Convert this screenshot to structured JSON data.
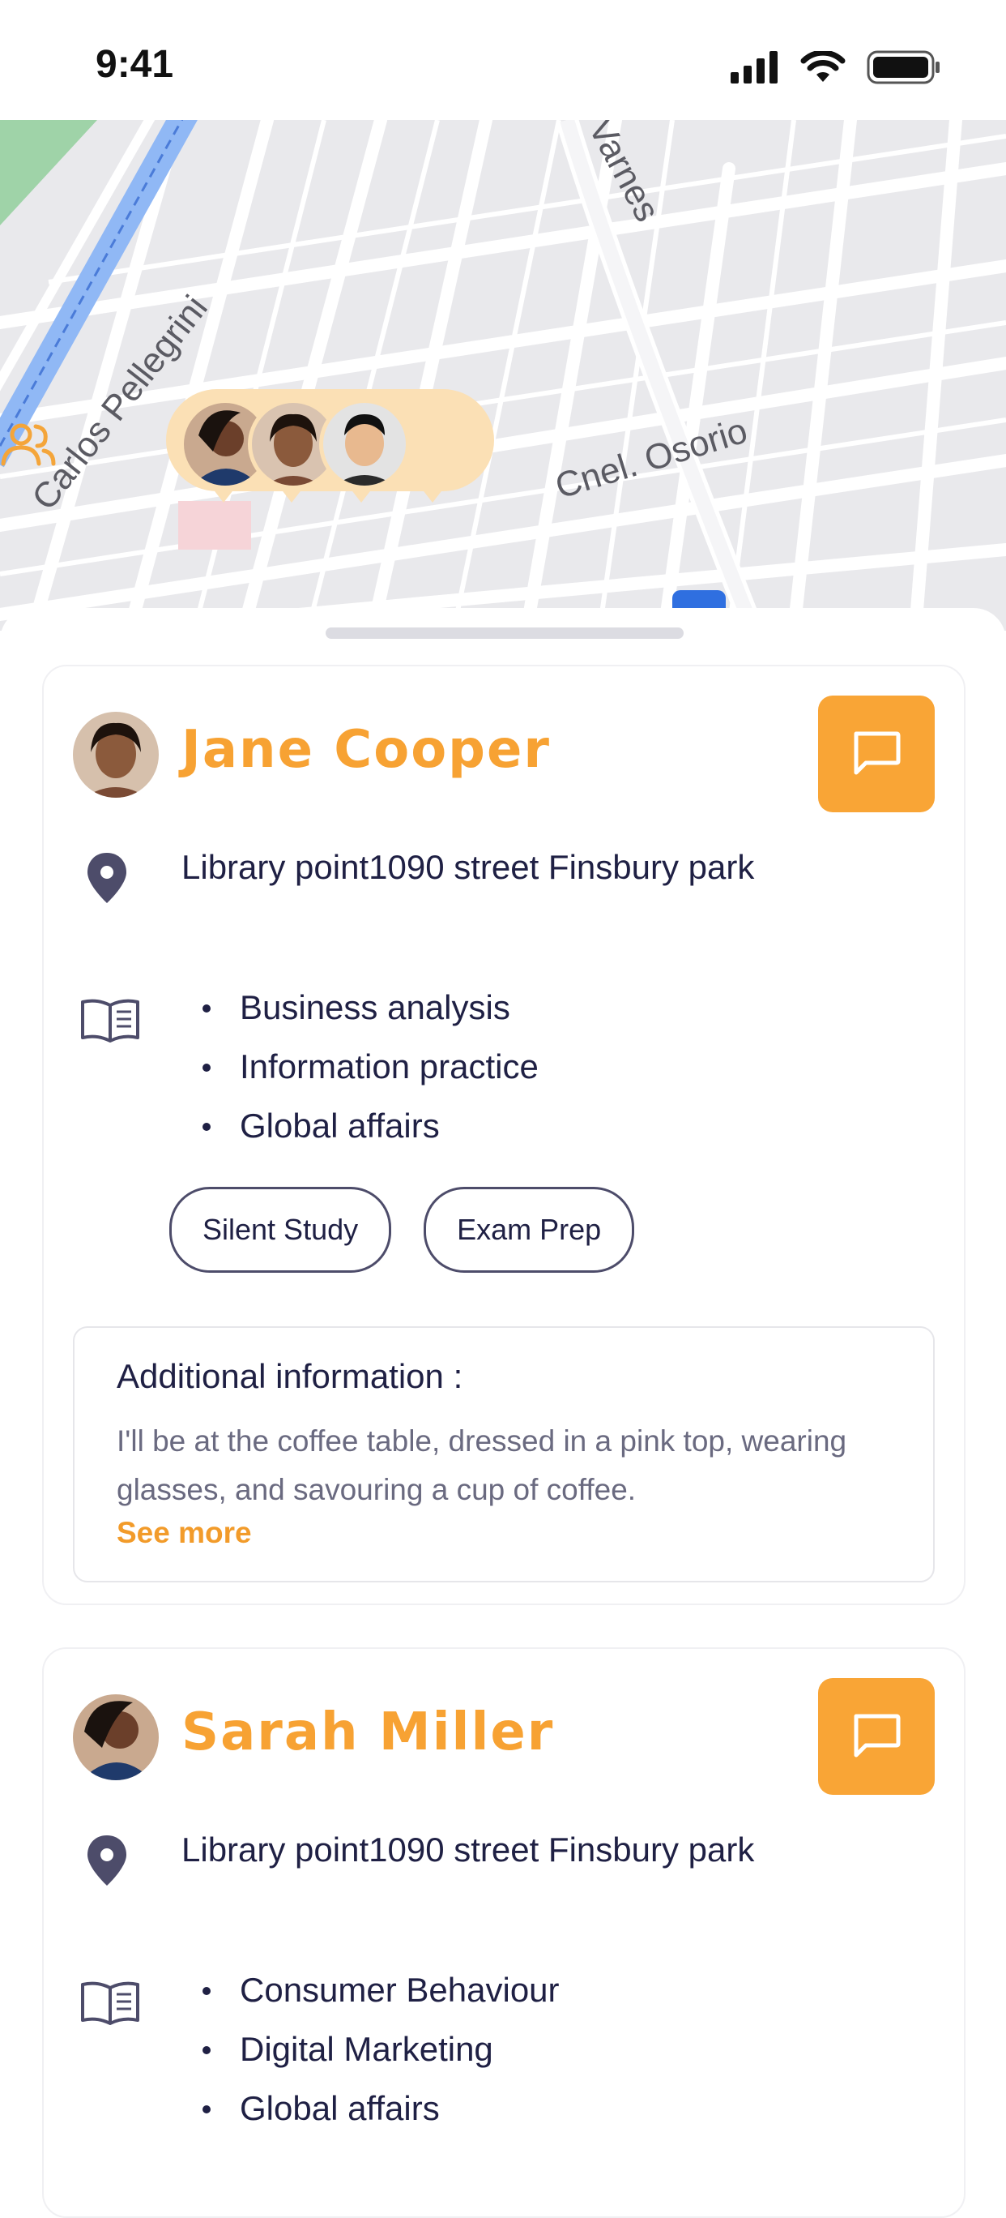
{
  "status_bar": {
    "time": "9:41"
  },
  "map": {
    "streets": [
      "Carlos Pellegrini",
      "Varnes",
      "Cnel. Osorio"
    ]
  },
  "people": [
    {
      "name": "Jane Cooper",
      "address": "Library point1090 street Finsbury park",
      "topics": [
        "Business analysis",
        "Information practice",
        "Global affairs"
      ],
      "tags": [
        "Silent Study",
        "Exam Prep"
      ],
      "info_title": "Additional information :",
      "info_text": "I'll be at the coffee table, dressed in a pink top, wearing glasses, and savouring a cup of coffee.",
      "see_more": "See more"
    },
    {
      "name": "Sarah Miller",
      "address": "Library point1090 street Finsbury park",
      "topics": [
        "Consumer Behaviour",
        "Digital Marketing",
        "Global affairs"
      ]
    }
  ],
  "colors": {
    "accent": "#F9A536",
    "text": "#1F2044",
    "muted": "#6A6A80"
  },
  "icons": [
    "signal-icon",
    "wifi-icon",
    "battery-icon",
    "group-icon",
    "chat-icon",
    "location-pin-icon",
    "book-icon"
  ]
}
